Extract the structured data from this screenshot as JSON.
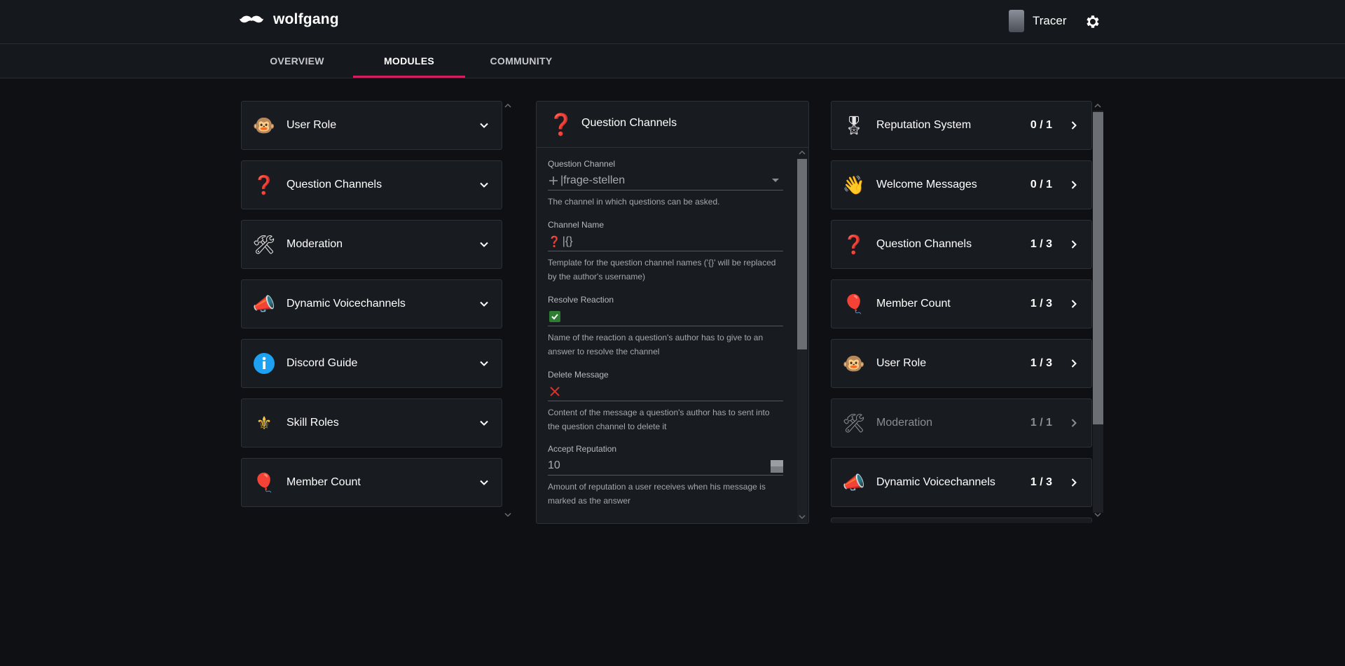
{
  "header": {
    "app_name": "wolfgang",
    "user_name": "Tracer"
  },
  "tabs": [
    {
      "label": "OVERVIEW",
      "active": false
    },
    {
      "label": "MODULES",
      "active": true
    },
    {
      "label": "COMMUNITY",
      "active": false
    }
  ],
  "left_modules": [
    {
      "label": "User Role",
      "icon": "monkey-icon"
    },
    {
      "label": "Question Channels",
      "icon": "question-mark-icon"
    },
    {
      "label": "Moderation",
      "icon": "tools-icon"
    },
    {
      "label": "Dynamic Voicechannels",
      "icon": "megaphone-icon"
    },
    {
      "label": "Discord Guide",
      "icon": "info-icon"
    },
    {
      "label": "Skill Roles",
      "icon": "fleur-de-lis-icon"
    },
    {
      "label": "Member Count",
      "icon": "balloons-icon"
    }
  ],
  "question_panel": {
    "title": "Question Channels",
    "fields": {
      "question_channel": {
        "label": "Question Channel",
        "value": "|frage-stellen",
        "help": "The channel in which questions can be asked."
      },
      "channel_name": {
        "label": "Channel Name",
        "value": "|{}",
        "help": "Template for the question channel names ('{}' will be replaced by the author's username)"
      },
      "resolve_reaction": {
        "label": "Resolve Reaction",
        "help": "Name of the reaction a question's author has to give to an answer to resolve the channel"
      },
      "delete_message": {
        "label": "Delete Message",
        "help": "Content of the message a question's author has to sent into the question channel to delete it"
      },
      "accept_reputation": {
        "label": "Accept Reputation",
        "value": "10",
        "help": "Amount of reputation a user receives when his message is marked as the answer"
      }
    }
  },
  "right_modules": [
    {
      "label": "Reputation System",
      "count": "0 / 1",
      "icon": "medal-icon",
      "disabled": false
    },
    {
      "label": "Welcome Messages",
      "count": "0 / 1",
      "icon": "waving-hand-icon",
      "disabled": false
    },
    {
      "label": "Question Channels",
      "count": "1 / 3",
      "icon": "question-mark-icon",
      "disabled": false
    },
    {
      "label": "Member Count",
      "count": "1 / 3",
      "icon": "balloons-icon",
      "disabled": false
    },
    {
      "label": "User Role",
      "count": "1 / 3",
      "icon": "monkey-icon",
      "disabled": false
    },
    {
      "label": "Moderation",
      "count": "1 / 1",
      "icon": "tools-icon",
      "disabled": true
    },
    {
      "label": "Dynamic Voicechannels",
      "count": "1 / 3",
      "icon": "megaphone-icon",
      "disabled": false
    }
  ],
  "colors": {
    "accent": "#d1205e",
    "background": "#0e1013",
    "card": "#181b20"
  }
}
